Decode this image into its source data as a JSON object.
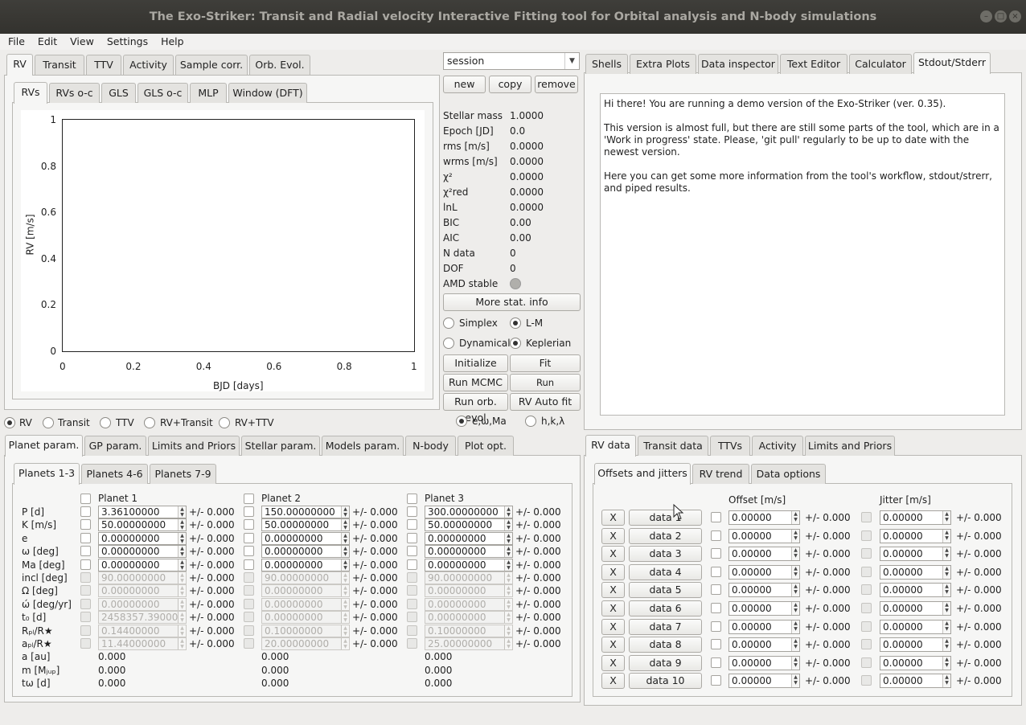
{
  "window": {
    "title": "The Exo-Striker:  Transit and Radial velocity Interactive Fitting tool for Orbital analysis and N-body simulations"
  },
  "menu": [
    "File",
    "Edit",
    "View",
    "Settings",
    "Help"
  ],
  "top_left_tabs": [
    "RV",
    "Transit",
    "TTV",
    "Activity",
    "Sample corr.",
    "Orb. Evol."
  ],
  "rv_subtabs": [
    "RVs",
    "RVs o-c",
    "GLS",
    "GLS o-c",
    "MLP",
    "Window (DFT)"
  ],
  "chart_data": {
    "type": "scatter",
    "xlabel": "BJD [days]",
    "ylabel": "RV [m/s]",
    "xlim": [
      0,
      1
    ],
    "ylim": [
      0,
      1
    ],
    "xticks": [
      "0",
      "0.2",
      "0.4",
      "0.6",
      "0.8",
      "1"
    ],
    "yticks": [
      "0",
      "0.2",
      "0.4",
      "0.6",
      "0.8",
      "1"
    ],
    "series": []
  },
  "fit_mode_radios": [
    "RV",
    "Transit",
    "TTV",
    "RV+Transit",
    "RV+TTV"
  ],
  "session": {
    "combo": "session",
    "new": "new",
    "copy": "copy",
    "remove": "remove"
  },
  "stats": [
    {
      "label": "Stellar mass",
      "value": "1.0000"
    },
    {
      "label": "Epoch [JD]",
      "value": "0.0"
    },
    {
      "label": "rms [m/s]",
      "value": "0.0000"
    },
    {
      "label": "wrms [m/s]",
      "value": "0.0000"
    },
    {
      "label": "χ²",
      "value": "0.0000"
    },
    {
      "label": "χ²red",
      "value": "0.0000"
    },
    {
      "label": "lnL",
      "value": "0.0000"
    },
    {
      "label": "BIC",
      "value": "0.00"
    },
    {
      "label": "AIC",
      "value": "0.00"
    },
    {
      "label": "N data",
      "value": "0"
    },
    {
      "label": "DOF",
      "value": "0"
    },
    {
      "label": "AMD stable",
      "value": ""
    }
  ],
  "controls": {
    "more_stat": "More stat. info",
    "simplex": "Simplex",
    "lm": "L-M",
    "dynamical": "Dynamical",
    "keplerian": "Keplerian",
    "initialize": "Initialize",
    "fit": "Fit",
    "run_mcmc": "Run MCMC",
    "run_nest": "Run Nest.samp.",
    "run_orb": "Run orb. evol",
    "rv_auto": "RV Auto fit",
    "ewma": "e,ω,Ma",
    "hkl": "h,k,λ"
  },
  "right_tabs": [
    "Shells",
    "Extra Plots",
    "Data inspector",
    "Text Editor",
    "Calculator",
    "Stdout/Stderr"
  ],
  "stdout": [
    "Hi there! You are running a demo version of the Exo-Striker (ver. 0.35).",
    "This version is almost full, but there are still some parts of the tool, which are in a 'Work in progress' state. Please, 'git pull' regularly to be up to date with the newest version.",
    "Here you can get some more information from the tool's workflow, stdout/strerr, and piped results."
  ],
  "bottom_left_tabs": [
    "Planet param.",
    "GP param.",
    "Limits and Priors",
    "Stellar param.",
    "Models param.",
    "N-body",
    "Plot opt."
  ],
  "planet_subtabs": [
    "Planets 1-3",
    "Planets 4-6",
    "Planets 7-9"
  ],
  "planet_names": [
    "Planet 1",
    "Planet 2",
    "Planet 3"
  ],
  "param_labels": [
    "P [d]",
    "K [m/s]",
    "e",
    "ω [deg]",
    "Ma [deg]",
    "incl [deg]",
    "Ω [deg]",
    "ώ [deg/yr]",
    "t₀ [d]",
    "Rₚₗ/R★",
    "aₚₗ/R★",
    "a [au]",
    "m [Mⱼᵤₚ]",
    "tω [d]"
  ],
  "planet_values": [
    [
      "3.36100000",
      "50.00000000",
      "0.00000000",
      "0.00000000",
      "0.00000000",
      "90.00000000",
      "0.00000000",
      "0.00000000",
      "2458357.390000",
      "0.14400000",
      "11.44000000"
    ],
    [
      "150.00000000",
      "50.00000000",
      "0.00000000",
      "0.00000000",
      "0.00000000",
      "90.00000000",
      "0.00000000",
      "0.00000000",
      "0.00000000",
      "0.10000000",
      "20.00000000"
    ],
    [
      "300.00000000",
      "50.00000000",
      "0.00000000",
      "0.00000000",
      "0.00000000",
      "90.00000000",
      "0.00000000",
      "0.00000000",
      "0.00000000",
      "0.10000000",
      "25.00000000"
    ]
  ],
  "planet_derived": [
    "0.000",
    "0.000",
    "0.000"
  ],
  "err_text": "+/- 0.000",
  "bottom_right_tabs": [
    "RV data",
    "Transit data",
    "TTVs",
    "Activity",
    "Limits and Priors"
  ],
  "rvdata_subtabs": [
    "Offsets and jitters",
    "RV trend",
    "Data options"
  ],
  "rvdata_headers": {
    "offset": "Offset [m/s]",
    "jitter": "Jitter [m/s]"
  },
  "rv_datasets": [
    {
      "x": "X",
      "name": "data 1",
      "offset": "0.00000",
      "jitter": "0.00000"
    },
    {
      "x": "X",
      "name": "data 2",
      "offset": "0.00000",
      "jitter": "0.00000"
    },
    {
      "x": "X",
      "name": "data 3",
      "offset": "0.00000",
      "jitter": "0.00000"
    },
    {
      "x": "X",
      "name": "data 4",
      "offset": "0.00000",
      "jitter": "0.00000"
    },
    {
      "x": "X",
      "name": "data 5",
      "offset": "0.00000",
      "jitter": "0.00000"
    },
    {
      "x": "X",
      "name": "data 6",
      "offset": "0.00000",
      "jitter": "0.00000"
    },
    {
      "x": "X",
      "name": "data 7",
      "offset": "0.00000",
      "jitter": "0.00000"
    },
    {
      "x": "X",
      "name": "data 8",
      "offset": "0.00000",
      "jitter": "0.00000"
    },
    {
      "x": "X",
      "name": "data 9",
      "offset": "0.00000",
      "jitter": "0.00000"
    },
    {
      "x": "X",
      "name": "data 10",
      "offset": "0.00000",
      "jitter": "0.00000"
    }
  ],
  "colors": {
    "titlebar": "#3a3935",
    "panel": "#f6f6f5",
    "window": "#eeedeb"
  }
}
